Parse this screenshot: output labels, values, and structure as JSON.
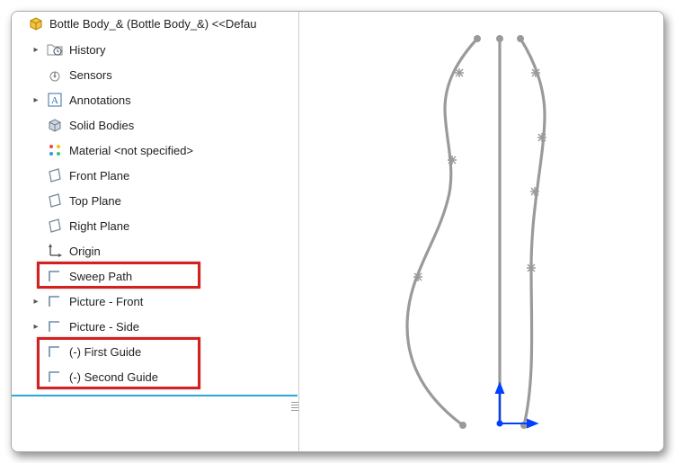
{
  "header": {
    "title": "Bottle Body_& (Bottle Body_&) <<Defau"
  },
  "tree": [
    {
      "label": "History",
      "icon": "folder-history",
      "expandable": true
    },
    {
      "label": "Sensors",
      "icon": "sensors",
      "expandable": false
    },
    {
      "label": "Annotations",
      "icon": "annotations",
      "expandable": true
    },
    {
      "label": "Solid Bodies",
      "icon": "solid-bodies",
      "expandable": false
    },
    {
      "label": "Material <not specified>",
      "icon": "material",
      "expandable": false
    },
    {
      "label": "Front Plane",
      "icon": "plane",
      "expandable": false
    },
    {
      "label": "Top Plane",
      "icon": "plane",
      "expandable": false
    },
    {
      "label": "Right Plane",
      "icon": "plane",
      "expandable": false
    },
    {
      "label": "Origin",
      "icon": "origin",
      "expandable": false
    },
    {
      "label": "Sweep Path",
      "icon": "sketch",
      "expandable": false
    },
    {
      "label": "Picture - Front",
      "icon": "sketch",
      "expandable": true
    },
    {
      "label": "Picture - Side",
      "icon": "sketch",
      "expandable": true
    },
    {
      "label": "(-) First Guide",
      "icon": "sketch",
      "expandable": false
    },
    {
      "label": "(-) Second Guide",
      "icon": "sketch",
      "expandable": false
    }
  ],
  "highlights": [
    {
      "start": 9,
      "end": 9
    },
    {
      "start": 12,
      "end": 13
    }
  ],
  "colors": {
    "highlight": "#d42020",
    "separator": "#2aa7d6",
    "curve": "#9a9a9a",
    "axis": "#0040ff"
  }
}
